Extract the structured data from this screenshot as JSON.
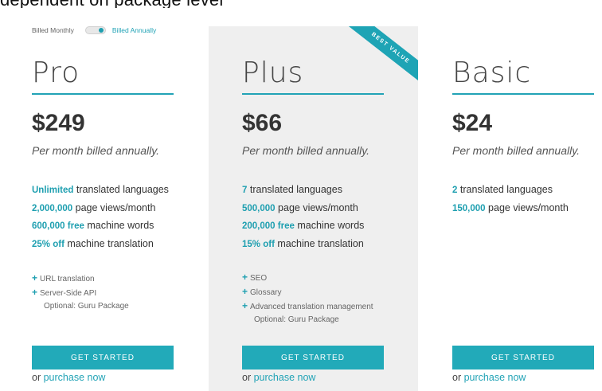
{
  "top_strip_text": "dependent on package level",
  "billing": {
    "monthly_label": "Billed Monthly",
    "annually_label": "Billed Annually"
  },
  "plans": [
    {
      "name": "Pro",
      "price": "$249",
      "period": "Per month billed annually.",
      "features": [
        {
          "highlight": "Unlimited",
          "text": " translated languages"
        },
        {
          "highlight": "2,000,000",
          "text": " page views/month"
        },
        {
          "highlight": "600,000 free",
          "text": " machine words"
        },
        {
          "highlight": "25% off",
          "text": " machine translation"
        }
      ],
      "extras": [
        "URL translation",
        "Server-Side API"
      ],
      "optional": "Optional: Guru Package",
      "cta": "GET STARTED",
      "purchase_prefix": "or ",
      "purchase_link": "purchase now"
    },
    {
      "name": "Plus",
      "ribbon": "BEST VALUE",
      "price": "$66",
      "period": "Per month billed annually.",
      "features": [
        {
          "highlight": "7",
          "text": " translated languages"
        },
        {
          "highlight": "500,000",
          "text": " page views/month"
        },
        {
          "highlight": "200,000 free",
          "text": " machine words"
        },
        {
          "highlight": "15% off",
          "text": " machine translation"
        }
      ],
      "extras": [
        "SEO",
        "Glossary",
        "Advanced translation management"
      ],
      "optional": "Optional: Guru Package",
      "cta": "GET STARTED",
      "purchase_prefix": "or ",
      "purchase_link": "purchase now"
    },
    {
      "name": "Basic",
      "price": "$24",
      "period": "Per month billed annually.",
      "features": [
        {
          "highlight": "2",
          "text": " translated languages"
        },
        {
          "highlight": "150,000",
          "text": " page views/month"
        }
      ],
      "extras": [],
      "cta": "GET STARTED",
      "purchase_prefix": "or ",
      "purchase_link": "purchase now"
    }
  ],
  "colors": {
    "accent": "#22aab9",
    "highlight_plan_bg": "#efefef"
  }
}
